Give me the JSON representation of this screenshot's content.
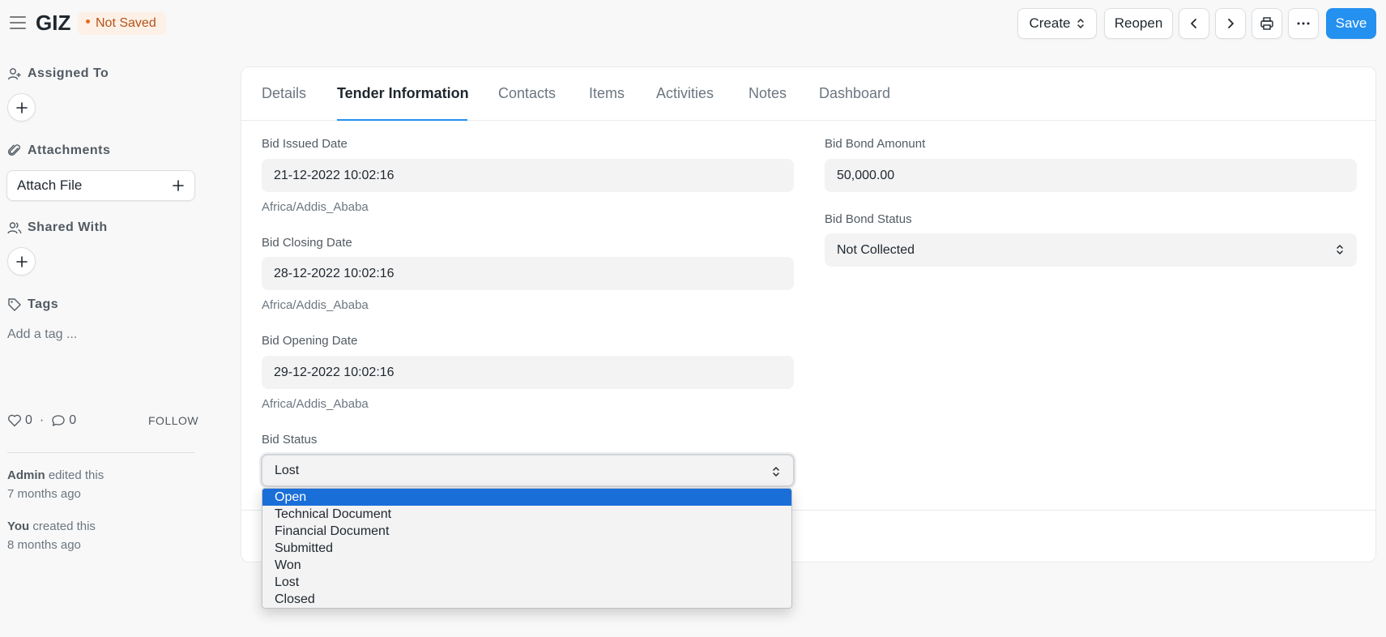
{
  "header": {
    "title": "GIZ",
    "status_indicator": "Not Saved",
    "buttons": {
      "create": "Create",
      "reopen": "Reopen",
      "save": "Save"
    }
  },
  "sidebar": {
    "assigned_to": "Assigned To",
    "attachments": "Attachments",
    "attach_file": "Attach File",
    "shared_with": "Shared With",
    "tags": "Tags",
    "add_tag": "Add a tag ...",
    "likes": "0",
    "comments": "0",
    "dot_separator": "·",
    "follow": "FOLLOW",
    "activity": [
      {
        "user": "Admin",
        "action": "edited this",
        "time": "7 months ago"
      },
      {
        "user": "You",
        "action": "created this",
        "time": "8 months ago"
      }
    ]
  },
  "tabs": [
    "Details",
    "Tender Information",
    "Contacts",
    "Items",
    "Activities",
    "Notes",
    "Dashboard"
  ],
  "active_tab": "Tender Information",
  "form": {
    "bid_issued_date": {
      "label": "Bid Issued Date",
      "value": "21-12-2022 10:02:16",
      "timezone": "Africa/Addis_Ababa"
    },
    "bid_closing_date": {
      "label": "Bid Closing Date",
      "value": "28-12-2022 10:02:16",
      "timezone": "Africa/Addis_Ababa"
    },
    "bid_opening_date": {
      "label": "Bid Opening Date",
      "value": "29-12-2022 10:02:16",
      "timezone": "Africa/Addis_Ababa"
    },
    "bid_status": {
      "label": "Bid Status",
      "value": "Lost",
      "options": [
        "Open",
        "Technical Document",
        "Financial Document",
        "Submitted",
        "Won",
        "Lost",
        "Closed"
      ],
      "highlighted_option": "Open"
    },
    "bid_bond_amount": {
      "label": "Bid Bond Amonunt",
      "value": "50,000.00"
    },
    "bid_bond_status": {
      "label": "Bid Bond Status",
      "value": "Not Collected"
    }
  },
  "colors": {
    "primary": "#2490ef",
    "indicator_text": "#b3541a",
    "indicator_bg": "#fdf0e6",
    "dropdown_highlight": "#1a6ed8"
  },
  "icons": [
    "hamburger-icon",
    "sort-icon",
    "chevron-left-icon",
    "chevron-right-icon",
    "printer-icon",
    "more-icon",
    "user-add-icon",
    "plus-icon",
    "paperclip-icon",
    "users-icon",
    "tag-icon",
    "heart-icon",
    "comment-icon"
  ]
}
